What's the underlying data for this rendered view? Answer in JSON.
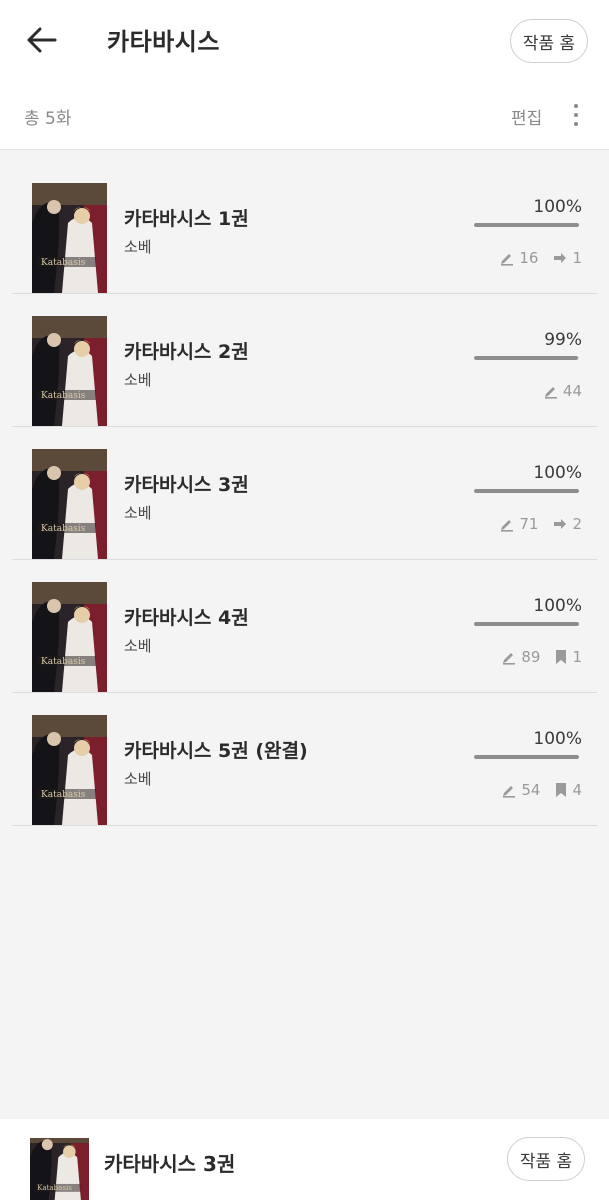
{
  "header": {
    "title": "카타바시스",
    "work_home_label": "작품 홈",
    "count_label": "총 5화",
    "edit_label": "편집"
  },
  "items": [
    {
      "title": "카타바시스 1권",
      "author": "소베",
      "progress_label": "100%",
      "progress": 1.0,
      "comments": "16",
      "second_stat": "1",
      "second_icon": "share-icon"
    },
    {
      "title": "카타바시스 2권",
      "author": "소베",
      "progress_label": "99%",
      "progress": 0.99,
      "comments": "44",
      "second_stat": null,
      "second_icon": null
    },
    {
      "title": "카타바시스 3권",
      "author": "소베",
      "progress_label": "100%",
      "progress": 1.0,
      "comments": "71",
      "second_stat": "2",
      "second_icon": "share-icon"
    },
    {
      "title": "카타바시스 4권",
      "author": "소베",
      "progress_label": "100%",
      "progress": 1.0,
      "comments": "89",
      "second_stat": "1",
      "second_icon": "bookmark-icon"
    },
    {
      "title": "카타바시스 5권 (완결)",
      "author": "소베",
      "progress_label": "100%",
      "progress": 1.0,
      "comments": "54",
      "second_stat": "4",
      "second_icon": "bookmark-icon"
    }
  ],
  "bottom_bar": {
    "current_title": "카타바시스 3권",
    "work_home_label": "작품 홈"
  },
  "colors": {
    "header_bg": "#ffffff",
    "list_bg": "#f4f4f5",
    "progress_fill": "#8d8d8d",
    "cover_dark": "#1c1c22",
    "cover_red": "#7a1f2b"
  }
}
